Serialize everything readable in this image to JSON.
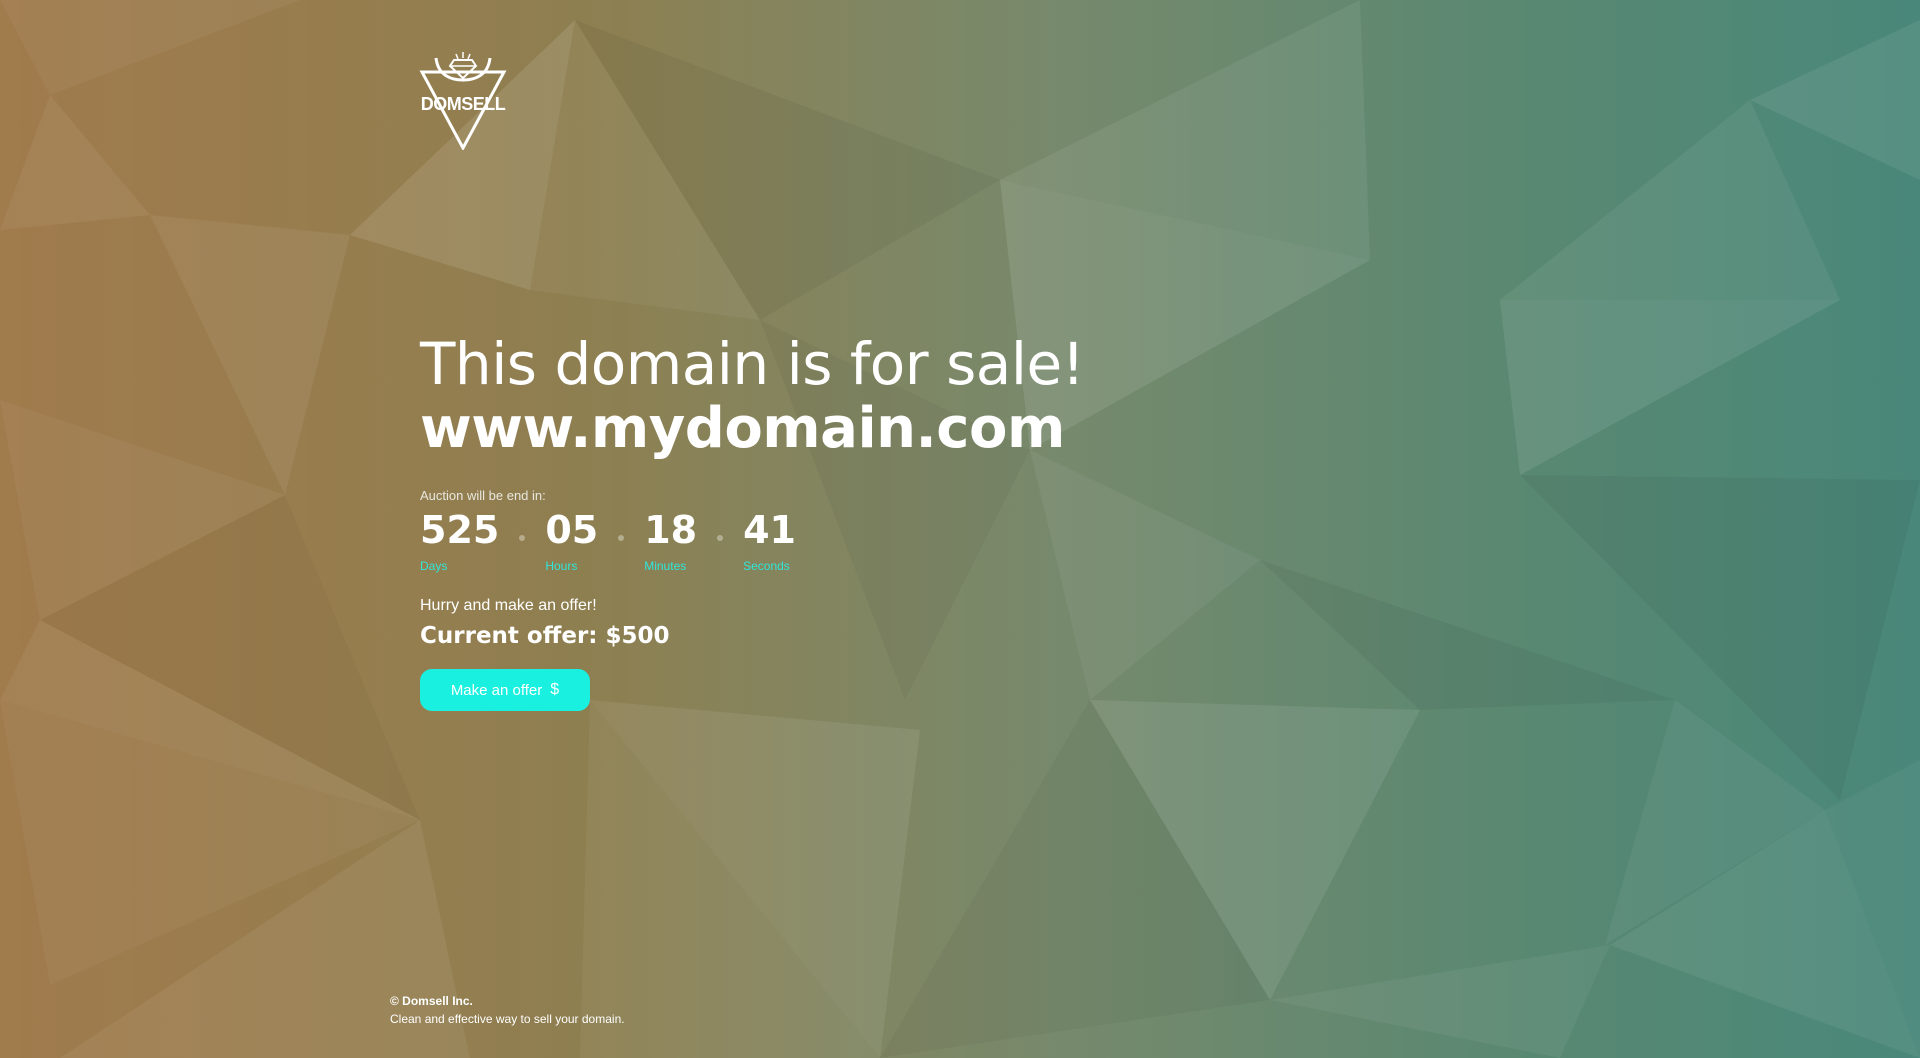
{
  "brand": {
    "name": "DOMSELL",
    "logo_icon": "diamond-antlers-triangle-icon"
  },
  "hero": {
    "headline": "This domain is for sale!",
    "domain": "www.mydomain.com"
  },
  "auction": {
    "label": "Auction will be end in:",
    "countdown": [
      {
        "value": "525",
        "label": "Days"
      },
      {
        "value": "05",
        "label": "Hours"
      },
      {
        "value": "18",
        "label": "Minutes"
      },
      {
        "value": "41",
        "label": "Seconds"
      }
    ]
  },
  "offer": {
    "hurry_text": "Hurry and make an offer!",
    "current_offer": "Current offer: $500",
    "button_label": "Make an offer",
    "button_icon": "$"
  },
  "footer": {
    "copyright": "© Domsell Inc.",
    "tagline": "Clean and effective way to sell your domain."
  },
  "colors": {
    "accent": "#1af0e0",
    "countdown_label": "#2fe6d8",
    "text": "#ffffff"
  }
}
